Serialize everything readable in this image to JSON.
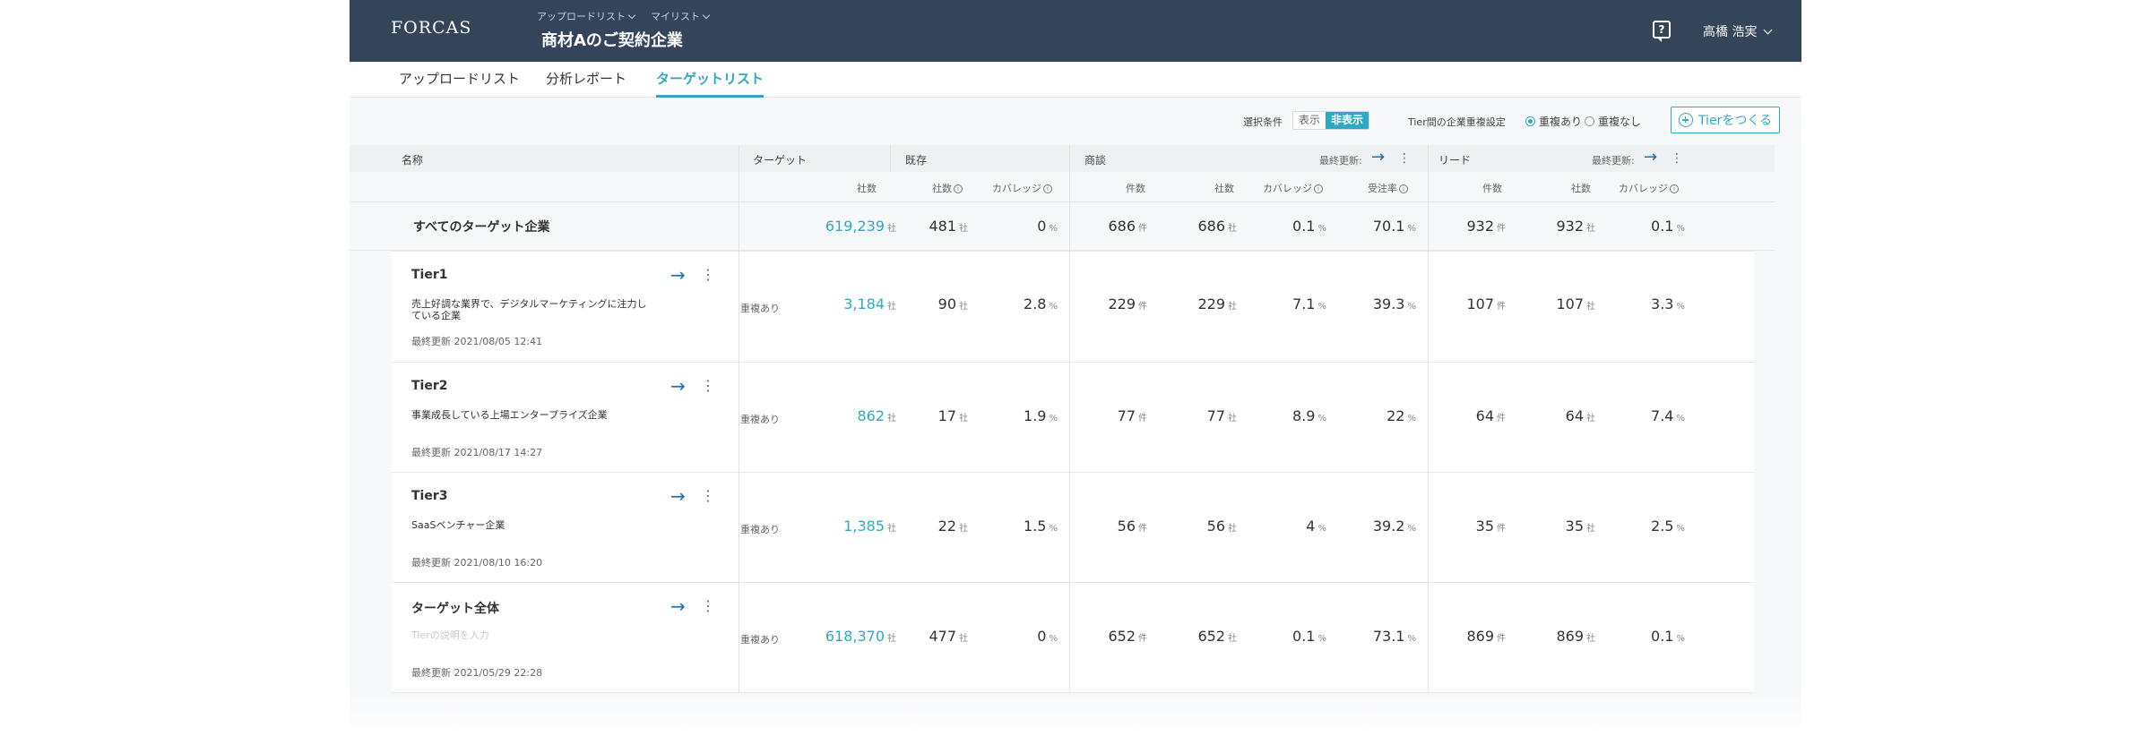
{
  "header": {
    "logo": "FORCAS",
    "crumbs": [
      "アップロードリスト",
      "マイリスト"
    ],
    "title": "商材Aのご契約企業",
    "help_symbol": "?",
    "user_name": "高橋 浩実"
  },
  "tabs": [
    "アップロードリスト",
    "分析レポート",
    "ターゲットリスト"
  ],
  "active_tab": "ターゲットリスト",
  "toolbar": {
    "selection_label": "選択条件",
    "show_label": "表示",
    "hide_label": "非表示",
    "overlap_label": "Tier間の企業重複設定",
    "overlap_yes": "重複あり",
    "overlap_no": "重複なし",
    "create_label": "Tierをつくる"
  },
  "table": {
    "headers": {
      "name": "名称",
      "target": "ターゲット",
      "existing": "既存",
      "deals": "商談",
      "leads": "リード",
      "last_updated": "最終更新:"
    },
    "subheaders": {
      "target_count": "社数",
      "existing_count": "社数",
      "existing_coverage": "カバレッジ",
      "deals_cases": "件数",
      "deals_count": "社数",
      "deals_coverage": "カバレッジ",
      "deals_win": "受注率",
      "leads_cases": "件数",
      "leads_count": "社数",
      "leads_coverage": "カバレッジ"
    },
    "units": {
      "company": "社",
      "percent": "%",
      "case": "件"
    },
    "summary": {
      "title": "すべてのターゲット企業",
      "target": "619,239",
      "existing_count": "481",
      "existing_coverage": "0",
      "deals_cases": "686",
      "deals_count": "686",
      "deals_coverage": "0.1",
      "deals_win": "70.1",
      "leads_cases": "932",
      "leads_count": "932",
      "leads_coverage": "0.1"
    },
    "rows": [
      {
        "name": "Tier1",
        "desc": "売上好調な業界で、デジタルマーケティングに注力している企業",
        "date_label": "最終更新",
        "date": "2021/08/05 12:41",
        "dup": "重複あり",
        "target": "3,184",
        "existing_count": "90",
        "existing_coverage": "2.8",
        "deals_cases": "229",
        "deals_count": "229",
        "deals_coverage": "7.1",
        "deals_win": "39.3",
        "leads_cases": "107",
        "leads_count": "107",
        "leads_coverage": "3.3"
      },
      {
        "name": "Tier2",
        "desc": "事業成長している上場エンタープライズ企業",
        "date_label": "最終更新",
        "date": "2021/08/17 14:27",
        "dup": "重複あり",
        "target": "862",
        "existing_count": "17",
        "existing_coverage": "1.9",
        "deals_cases": "77",
        "deals_count": "77",
        "deals_coverage": "8.9",
        "deals_win": "22",
        "leads_cases": "64",
        "leads_count": "64",
        "leads_coverage": "7.4"
      },
      {
        "name": "Tier3",
        "desc": "SaaSベンチャー企業",
        "date_label": "最終更新",
        "date": "2021/08/10 16:20",
        "dup": "重複あり",
        "target": "1,385",
        "existing_count": "22",
        "existing_coverage": "1.5",
        "deals_cases": "56",
        "deals_count": "56",
        "deals_coverage": "4",
        "deals_win": "39.2",
        "leads_cases": "35",
        "leads_count": "35",
        "leads_coverage": "2.5"
      },
      {
        "name": "ターゲット全体",
        "desc": "Tierの説明を入力",
        "date_label": "最終更新",
        "date": "2021/05/29 22:28",
        "dup": "重複あり",
        "target": "618,370",
        "existing_count": "477",
        "existing_coverage": "0",
        "deals_cases": "652",
        "deals_count": "652",
        "deals_coverage": "0.1",
        "deals_win": "73.1",
        "leads_cases": "869",
        "leads_count": "869",
        "leads_coverage": "0.1"
      }
    ]
  },
  "colors": {
    "header_bg": "#34455a",
    "accent": "#2fa8c4",
    "arrow": "#1f6fb5"
  },
  "icons": {
    "arrow": "arrow-right-icon",
    "menu": "kebab-menu-icon",
    "info": "info-icon",
    "help": "help-icon"
  }
}
